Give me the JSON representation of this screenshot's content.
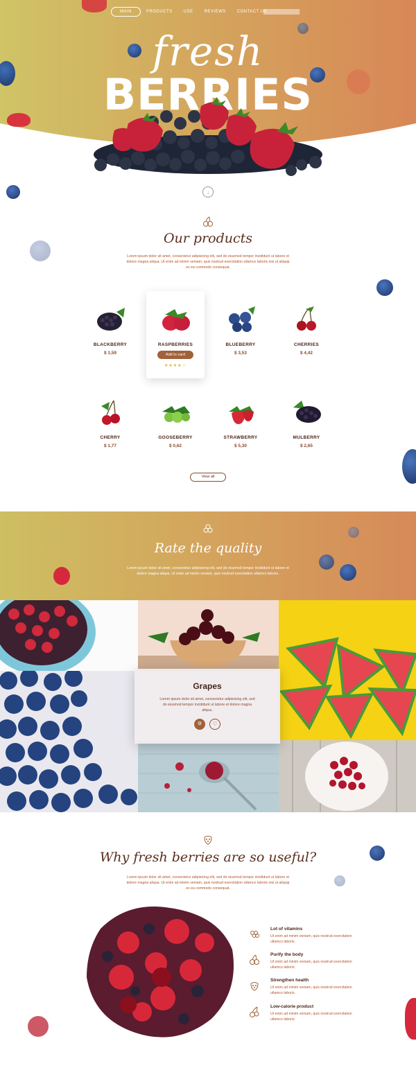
{
  "nav": {
    "items": [
      "MAIN",
      "PRODUCTS",
      "USE",
      "REVIEWS",
      "CONTACT US"
    ]
  },
  "hero": {
    "script": "fresh",
    "title": "BERRIES",
    "scroll_icon": "arrow-down-icon"
  },
  "products_section": {
    "icon": "cherries-icon",
    "title": "Our products",
    "text": "Lorem ipsum dolor sit amet, consectetur adipisicing elit, sed do eiusmod tempor incididunt ut labore et dolore magna aliqua. Ut enim ad minim veniam, quis nostrud exercitation ullamco laboris nisi ut aliquip ex ea commodo consequat.",
    "add_label": "Add to card",
    "rating_stars": "★★★★☆",
    "rating": 4,
    "view_all": "View all",
    "items": [
      {
        "name": "BLACKBERRY",
        "price": "$ 1,59"
      },
      {
        "name": "RASPBERRIES",
        "price": ""
      },
      {
        "name": "BLUEBERRY",
        "price": "$ 3,53"
      },
      {
        "name": "CHERRIES",
        "price": "$ 4,42"
      },
      {
        "name": "CHERRY",
        "price": "$ 1,77"
      },
      {
        "name": "GOOSEBERRY",
        "price": "$ 0,62"
      },
      {
        "name": "STRAWBERRY",
        "price": "$ 5,30"
      },
      {
        "name": "MULBERRY",
        "price": "$ 2,65"
      }
    ]
  },
  "rate_section": {
    "icon": "berries-icon",
    "title": "Rate the quality",
    "text": "Lorem ipsum dolor sit amet, consectetur adipisicing elit, sed do eiusmod tempor incididunt ut labore et dolore magna aliqua. Ut enim ad minim veniam, quis nostrud exercitation ullamco laboris.",
    "card": {
      "title": "Grapes",
      "text": "Lorem ipsum dolor sit amet, consectetur adipisicing elit, sed do eiusmod tempor incididunt ut labore et dolore magna aliqua.",
      "cart_icon": "cart-icon",
      "fav_icon": "heart-icon"
    }
  },
  "why_section": {
    "icon": "raspberry-icon",
    "title": "Why fresh berries are so useful?",
    "text": "Lorem ipsum dolor sit amet, consectetur adipisicing elit, sed do eiusmod tempor incididunt ut labore et dolore magna aliqua. Ut enim ad minim veniam, quis nostrud exercitation ullamco laboris nisi ut aliquip ex ea commodo consequat.",
    "benefits": [
      {
        "title": "Lot of vitamins",
        "text": "Ut enim ad minim veniam, quis nostrud exercitation ullamco laboris.",
        "icon": "grapes-icon"
      },
      {
        "title": "Purify the body",
        "text": "Ut enim ad minim veniam, quis nostrud exercitation ullamco laboris.",
        "icon": "cherries-icon"
      },
      {
        "title": "Strengthen health",
        "text": "Ut enim ad minim veniam, quis nostrud exercitation ullamco laboris.",
        "icon": "raspberry-icon"
      },
      {
        "title": "Low-calorie product",
        "text": "Ut enim ad minim veniam, quis nostrud exercitation ullamco laboris.",
        "icon": "cherry-icon"
      }
    ]
  },
  "colors": {
    "accent": "#a0623a",
    "dark_text": "#4a2318",
    "body_text": "#b3542b",
    "gradient_start": "#cdbf62",
    "gradient_end": "#d68a58"
  }
}
